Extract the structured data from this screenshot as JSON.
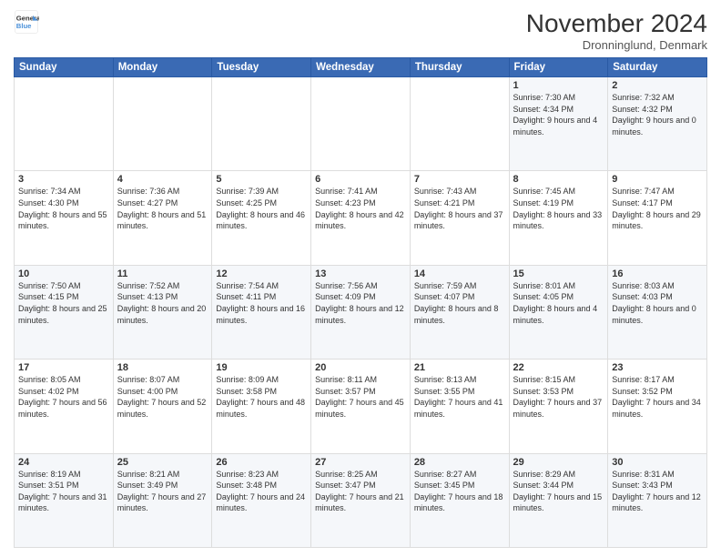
{
  "logo": {
    "line1": "General",
    "line2": "Blue"
  },
  "title": "November 2024",
  "location": "Dronninglund, Denmark",
  "days_of_week": [
    "Sunday",
    "Monday",
    "Tuesday",
    "Wednesday",
    "Thursday",
    "Friday",
    "Saturday"
  ],
  "weeks": [
    [
      {
        "day": "",
        "info": ""
      },
      {
        "day": "",
        "info": ""
      },
      {
        "day": "",
        "info": ""
      },
      {
        "day": "",
        "info": ""
      },
      {
        "day": "",
        "info": ""
      },
      {
        "day": "1",
        "info": "Sunrise: 7:30 AM\nSunset: 4:34 PM\nDaylight: 9 hours and 4 minutes."
      },
      {
        "day": "2",
        "info": "Sunrise: 7:32 AM\nSunset: 4:32 PM\nDaylight: 9 hours and 0 minutes."
      }
    ],
    [
      {
        "day": "3",
        "info": "Sunrise: 7:34 AM\nSunset: 4:30 PM\nDaylight: 8 hours and 55 minutes."
      },
      {
        "day": "4",
        "info": "Sunrise: 7:36 AM\nSunset: 4:27 PM\nDaylight: 8 hours and 51 minutes."
      },
      {
        "day": "5",
        "info": "Sunrise: 7:39 AM\nSunset: 4:25 PM\nDaylight: 8 hours and 46 minutes."
      },
      {
        "day": "6",
        "info": "Sunrise: 7:41 AM\nSunset: 4:23 PM\nDaylight: 8 hours and 42 minutes."
      },
      {
        "day": "7",
        "info": "Sunrise: 7:43 AM\nSunset: 4:21 PM\nDaylight: 8 hours and 37 minutes."
      },
      {
        "day": "8",
        "info": "Sunrise: 7:45 AM\nSunset: 4:19 PM\nDaylight: 8 hours and 33 minutes."
      },
      {
        "day": "9",
        "info": "Sunrise: 7:47 AM\nSunset: 4:17 PM\nDaylight: 8 hours and 29 minutes."
      }
    ],
    [
      {
        "day": "10",
        "info": "Sunrise: 7:50 AM\nSunset: 4:15 PM\nDaylight: 8 hours and 25 minutes."
      },
      {
        "day": "11",
        "info": "Sunrise: 7:52 AM\nSunset: 4:13 PM\nDaylight: 8 hours and 20 minutes."
      },
      {
        "day": "12",
        "info": "Sunrise: 7:54 AM\nSunset: 4:11 PM\nDaylight: 8 hours and 16 minutes."
      },
      {
        "day": "13",
        "info": "Sunrise: 7:56 AM\nSunset: 4:09 PM\nDaylight: 8 hours and 12 minutes."
      },
      {
        "day": "14",
        "info": "Sunrise: 7:59 AM\nSunset: 4:07 PM\nDaylight: 8 hours and 8 minutes."
      },
      {
        "day": "15",
        "info": "Sunrise: 8:01 AM\nSunset: 4:05 PM\nDaylight: 8 hours and 4 minutes."
      },
      {
        "day": "16",
        "info": "Sunrise: 8:03 AM\nSunset: 4:03 PM\nDaylight: 8 hours and 0 minutes."
      }
    ],
    [
      {
        "day": "17",
        "info": "Sunrise: 8:05 AM\nSunset: 4:02 PM\nDaylight: 7 hours and 56 minutes."
      },
      {
        "day": "18",
        "info": "Sunrise: 8:07 AM\nSunset: 4:00 PM\nDaylight: 7 hours and 52 minutes."
      },
      {
        "day": "19",
        "info": "Sunrise: 8:09 AM\nSunset: 3:58 PM\nDaylight: 7 hours and 48 minutes."
      },
      {
        "day": "20",
        "info": "Sunrise: 8:11 AM\nSunset: 3:57 PM\nDaylight: 7 hours and 45 minutes."
      },
      {
        "day": "21",
        "info": "Sunrise: 8:13 AM\nSunset: 3:55 PM\nDaylight: 7 hours and 41 minutes."
      },
      {
        "day": "22",
        "info": "Sunrise: 8:15 AM\nSunset: 3:53 PM\nDaylight: 7 hours and 37 minutes."
      },
      {
        "day": "23",
        "info": "Sunrise: 8:17 AM\nSunset: 3:52 PM\nDaylight: 7 hours and 34 minutes."
      }
    ],
    [
      {
        "day": "24",
        "info": "Sunrise: 8:19 AM\nSunset: 3:51 PM\nDaylight: 7 hours and 31 minutes."
      },
      {
        "day": "25",
        "info": "Sunrise: 8:21 AM\nSunset: 3:49 PM\nDaylight: 7 hours and 27 minutes."
      },
      {
        "day": "26",
        "info": "Sunrise: 8:23 AM\nSunset: 3:48 PM\nDaylight: 7 hours and 24 minutes."
      },
      {
        "day": "27",
        "info": "Sunrise: 8:25 AM\nSunset: 3:47 PM\nDaylight: 7 hours and 21 minutes."
      },
      {
        "day": "28",
        "info": "Sunrise: 8:27 AM\nSunset: 3:45 PM\nDaylight: 7 hours and 18 minutes."
      },
      {
        "day": "29",
        "info": "Sunrise: 8:29 AM\nSunset: 3:44 PM\nDaylight: 7 hours and 15 minutes."
      },
      {
        "day": "30",
        "info": "Sunrise: 8:31 AM\nSunset: 3:43 PM\nDaylight: 7 hours and 12 minutes."
      }
    ]
  ]
}
